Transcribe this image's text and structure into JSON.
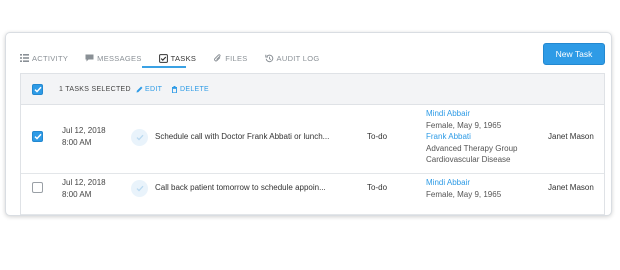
{
  "tabs": [
    {
      "label": "ACTIVITY",
      "icon": "list-icon"
    },
    {
      "label": "MESSAGES",
      "icon": "message-icon"
    },
    {
      "label": "TASKS",
      "icon": "checkbox-icon"
    },
    {
      "label": "FILES",
      "icon": "paperclip-icon"
    },
    {
      "label": "AUDIT LOG",
      "icon": "history-icon"
    }
  ],
  "new_task_label": "New Task",
  "toolbar": {
    "selected_text": "1 TASKS SELECTED",
    "edit_label": "EDIT",
    "delete_label": "DELETE"
  },
  "rows": [
    {
      "checked": true,
      "date": "Jul 12, 2018",
      "time": "8:00 AM",
      "task": "Schedule call with Doctor Frank Abbati or lunch...",
      "status": "To-do",
      "patient_name": "Mindi Abbair",
      "patient_info": "Female, May 9, 1965",
      "doctor_name": "Frank Abbati",
      "doctor_group": "Advanced Therapy Group",
      "doctor_specialty": "Cardiovascular Disease",
      "owner": "Janet Mason"
    },
    {
      "checked": false,
      "date": "Jul 12, 2018",
      "time": "8:00 AM",
      "task": "Call back patient tomorrow to schedule appoin...",
      "status": "To-do",
      "patient_name": "Mindi Abbair",
      "patient_info": "Female, May 9, 1965",
      "owner": "Janet Mason"
    }
  ],
  "colors": {
    "accent": "#2e9be6",
    "header_bg": "#f3f4f6"
  }
}
